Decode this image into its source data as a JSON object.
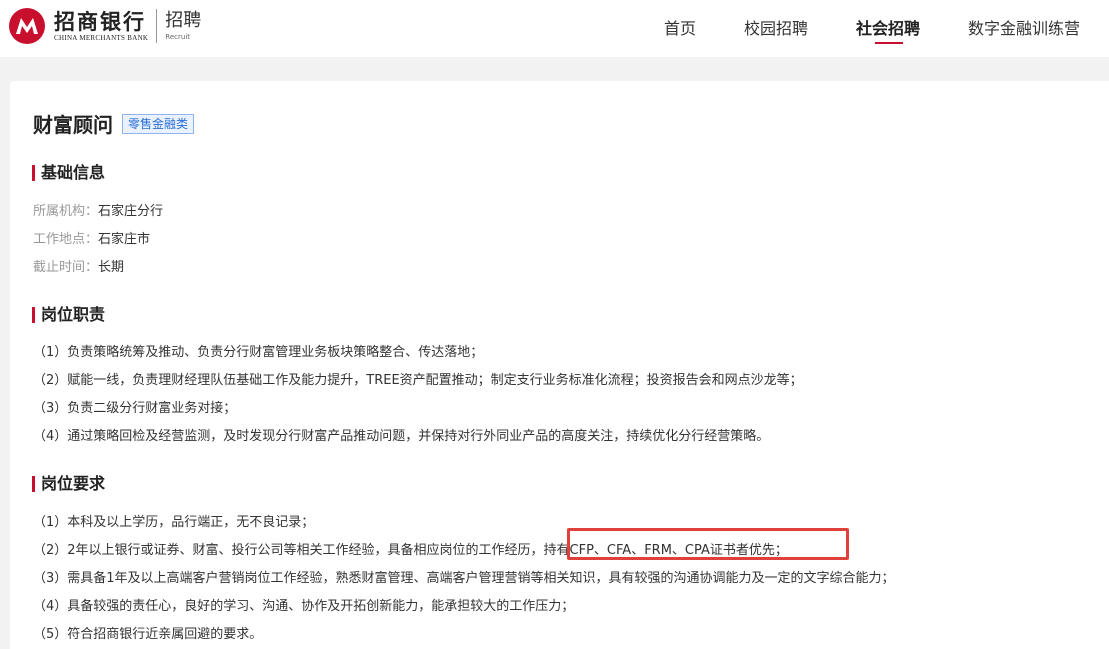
{
  "logo": {
    "name_cn": "招商银行",
    "name_en": "CHINA MERCHANTS BANK",
    "sub_cn": "招聘",
    "sub_en": "Recruit",
    "brand_color": "#c8102e"
  },
  "nav": {
    "items": [
      "首页",
      "校园招聘",
      "社会招聘",
      "数字金融训练营"
    ],
    "active": "社会招聘"
  },
  "job": {
    "title": "财富顾问",
    "tag": "零售金融类"
  },
  "basic": {
    "heading": "基础信息",
    "rows": [
      {
        "label": "所属机构：",
        "value": "石家庄分行"
      },
      {
        "label": "工作地点：",
        "value": "石家庄市"
      },
      {
        "label": "截止时间：",
        "value": "长期"
      }
    ]
  },
  "duties": {
    "heading": "岗位职责",
    "items": [
      "（1）负责策略统筹及推动、负责分行财富管理业务板块策略整合、传达落地；",
      "（2）赋能一线，负责理财经理队伍基础工作及能力提升，TREE资产配置推动；制定支行业务标准化流程；投资报告会和网点沙龙等；",
      "（3）负责二级分行财富业务对接；",
      "（4）通过策略回检及经营监测，及时发现分行财富产品推动问题，并保持对行外同业产品的高度关注，持续优化分行经营策略。"
    ]
  },
  "requirements": {
    "heading": "岗位要求",
    "items": [
      "（1）本科及以上学历，品行端正，无不良记录；",
      "（2）2年以上银行或证券、财富、投行公司等相关工作经验，具备相应岗位的工作经历，持有CFP、CFA、FRM、CPA证书者优先；",
      "（3）需具备1年及以上高端客户营销岗位工作经验，熟悉财富管理、高端客户管理营销等相关知识，具有较强的沟通协调能力及一定的文字综合能力；",
      "（4）具备较强的责任心，良好的学习、沟通、协作及开拓创新能力，能承担较大的工作压力；",
      "（5）符合招商银行近亲属回避的要求。"
    ]
  },
  "highlight_color": "#e0403a"
}
